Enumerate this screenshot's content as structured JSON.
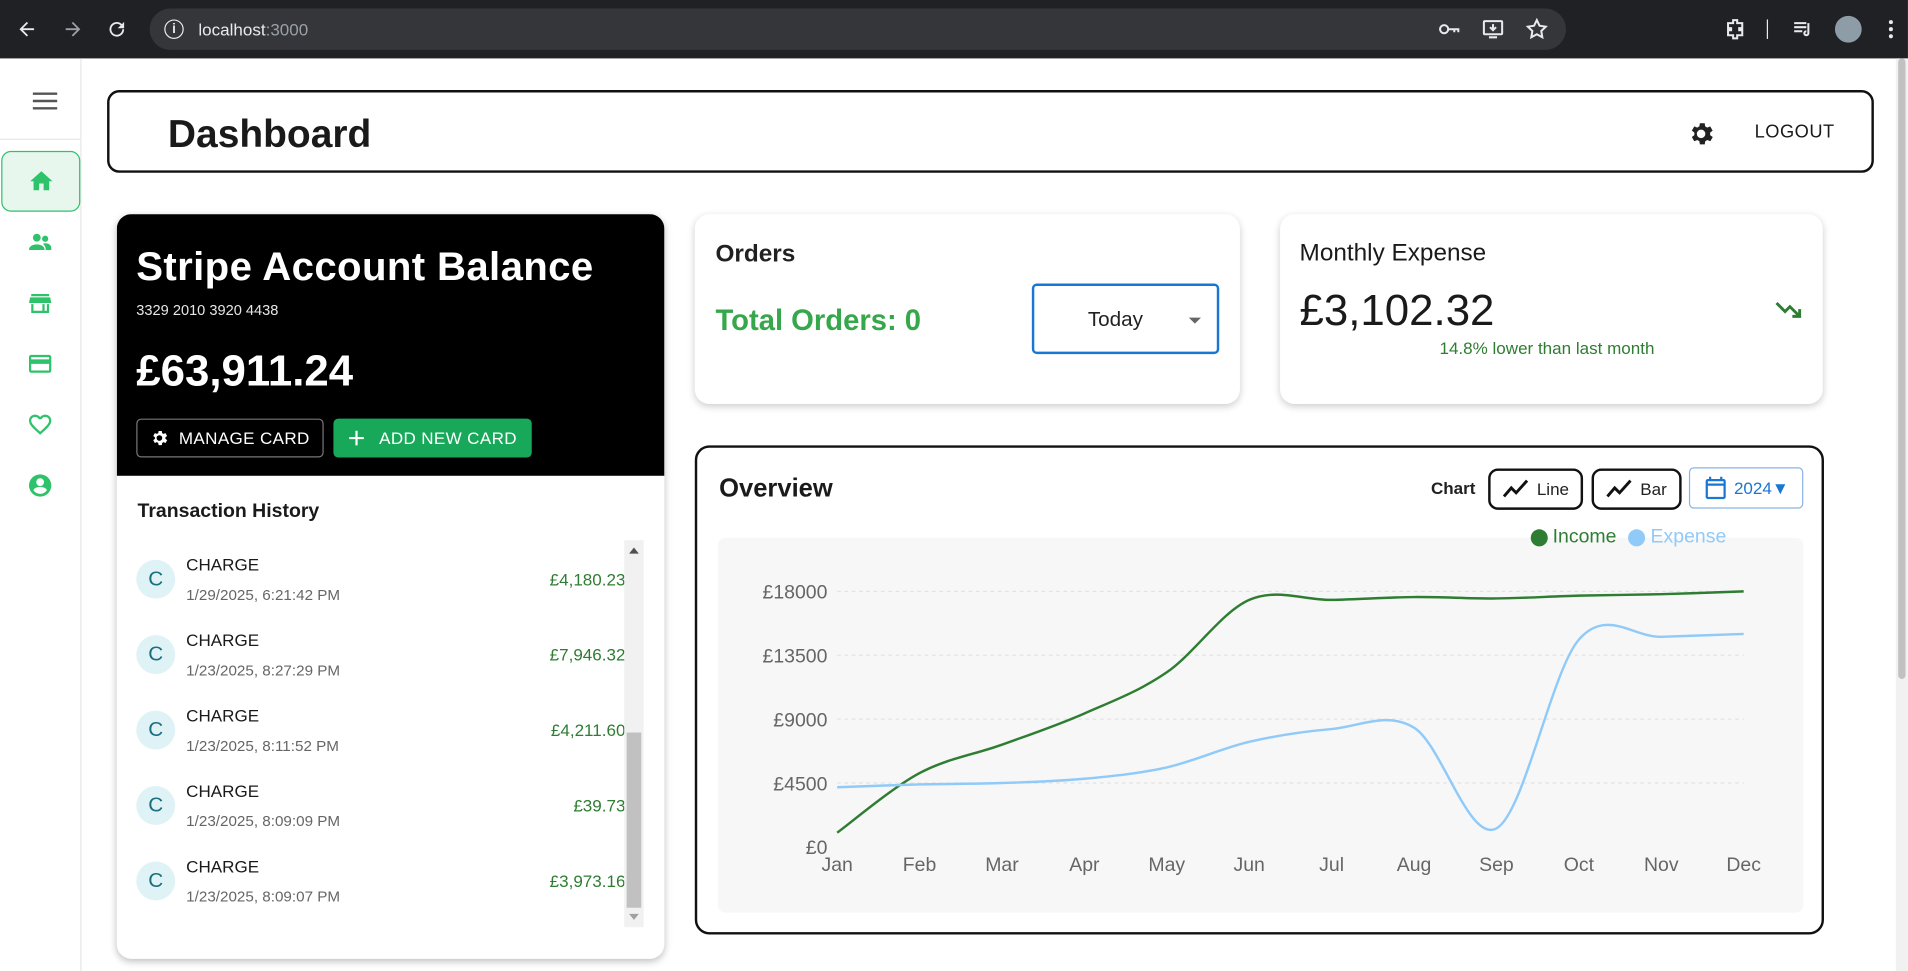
{
  "browser": {
    "host": "localhost",
    "port": ":3000"
  },
  "header": {
    "title": "Dashboard",
    "logout_label": "LOGOUT"
  },
  "sidebar": {
    "items": [
      {
        "icon": "home-icon",
        "active": true
      },
      {
        "icon": "people-icon",
        "active": false
      },
      {
        "icon": "store-icon",
        "active": false
      },
      {
        "icon": "credit-card-icon",
        "active": false
      },
      {
        "icon": "heart-icon",
        "active": false
      },
      {
        "icon": "account-circle-icon",
        "active": false
      }
    ]
  },
  "balance_card": {
    "title": "Stripe Account Balance",
    "card_number": "3329 2010 3920 4438",
    "amount": "£63,911.24",
    "manage_label": "MANAGE CARD",
    "add_label": "ADD NEW CARD"
  },
  "transactions": {
    "title": "Transaction History",
    "items": [
      {
        "avatar": "C",
        "kind": "CHARGE",
        "date": "1/29/2025, 6:21:42 PM",
        "amount": "£4,180.23"
      },
      {
        "avatar": "C",
        "kind": "CHARGE",
        "date": "1/23/2025, 8:27:29 PM",
        "amount": "£7,946.32"
      },
      {
        "avatar": "C",
        "kind": "CHARGE",
        "date": "1/23/2025, 8:11:52 PM",
        "amount": "£4,211.60"
      },
      {
        "avatar": "C",
        "kind": "CHARGE",
        "date": "1/23/2025, 8:09:09 PM",
        "amount": "£39.73"
      },
      {
        "avatar": "C",
        "kind": "CHARGE",
        "date": "1/23/2025, 8:09:07 PM",
        "amount": "£3,973.16"
      }
    ]
  },
  "orders": {
    "title": "Orders",
    "total": "Total Orders: 0",
    "period": "Today"
  },
  "expense": {
    "title": "Monthly Expense",
    "amount": "£3,102.32",
    "note": "14.8% lower than last month"
  },
  "overview": {
    "title": "Overview",
    "chart_label": "Chart",
    "line_label": "Line",
    "bar_label": "Bar",
    "year": "2024▼"
  },
  "colors": {
    "accent": "#2ec26a",
    "income": "#2e7d32",
    "expense": "#90caf9"
  },
  "chart_data": {
    "type": "line",
    "categories": [
      "Jan",
      "Feb",
      "Mar",
      "Apr",
      "May",
      "Jun",
      "Jul",
      "Aug",
      "Sep",
      "Oct",
      "Nov",
      "Dec"
    ],
    "series": [
      {
        "name": "Income",
        "values": [
          1000,
          5200,
          7200,
          9400,
          12300,
          17400,
          17400,
          17600,
          17500,
          17700,
          17800,
          18000
        ]
      },
      {
        "name": "Expense",
        "values": [
          4200,
          4400,
          4500,
          4800,
          5600,
          7400,
          8300,
          8400,
          1300,
          14600,
          14800,
          15000
        ]
      }
    ],
    "ylim": [
      0,
      18000
    ],
    "yticks": [
      "£0",
      "£4500",
      "£9000",
      "£13500",
      "£18000"
    ],
    "legend": "top-right",
    "grid": true
  }
}
